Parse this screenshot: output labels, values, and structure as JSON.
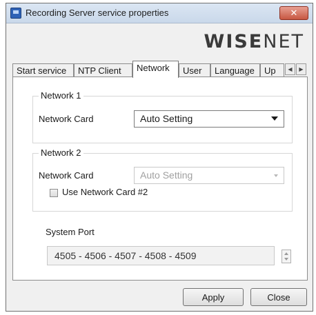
{
  "window": {
    "title": "Recording Server service properties",
    "close_symbol": "✕",
    "icon": "app-window-icon"
  },
  "logo": {
    "text_bold": "WISE",
    "text_light": "NET"
  },
  "tabs": [
    {
      "label": "Start service",
      "active": false
    },
    {
      "label": "NTP Client",
      "active": false
    },
    {
      "label": "Network",
      "active": true
    },
    {
      "label": "User",
      "active": false
    },
    {
      "label": "Language",
      "active": false
    },
    {
      "label": "Up",
      "active": false
    }
  ],
  "tab_scroll": {
    "left": "◀",
    "right": "▶"
  },
  "network1": {
    "group_label": "Network 1",
    "card_label": "Network Card",
    "card_value": "Auto Setting"
  },
  "network2": {
    "group_label": "Network 2",
    "card_label": "Network Card",
    "card_value": "Auto Setting",
    "use_card_label": "Use Network Card #2",
    "use_card_checked": false
  },
  "system_port": {
    "label": "System Port",
    "value": "4505 - 4506 - 4507 - 4508 - 4509"
  },
  "buttons": {
    "apply": "Apply",
    "close": "Close"
  },
  "colors": {
    "titlebar": "#c9d8ea",
    "close_button": "#c75742",
    "panel": "#ffffff",
    "dialog": "#f0f0f0"
  }
}
